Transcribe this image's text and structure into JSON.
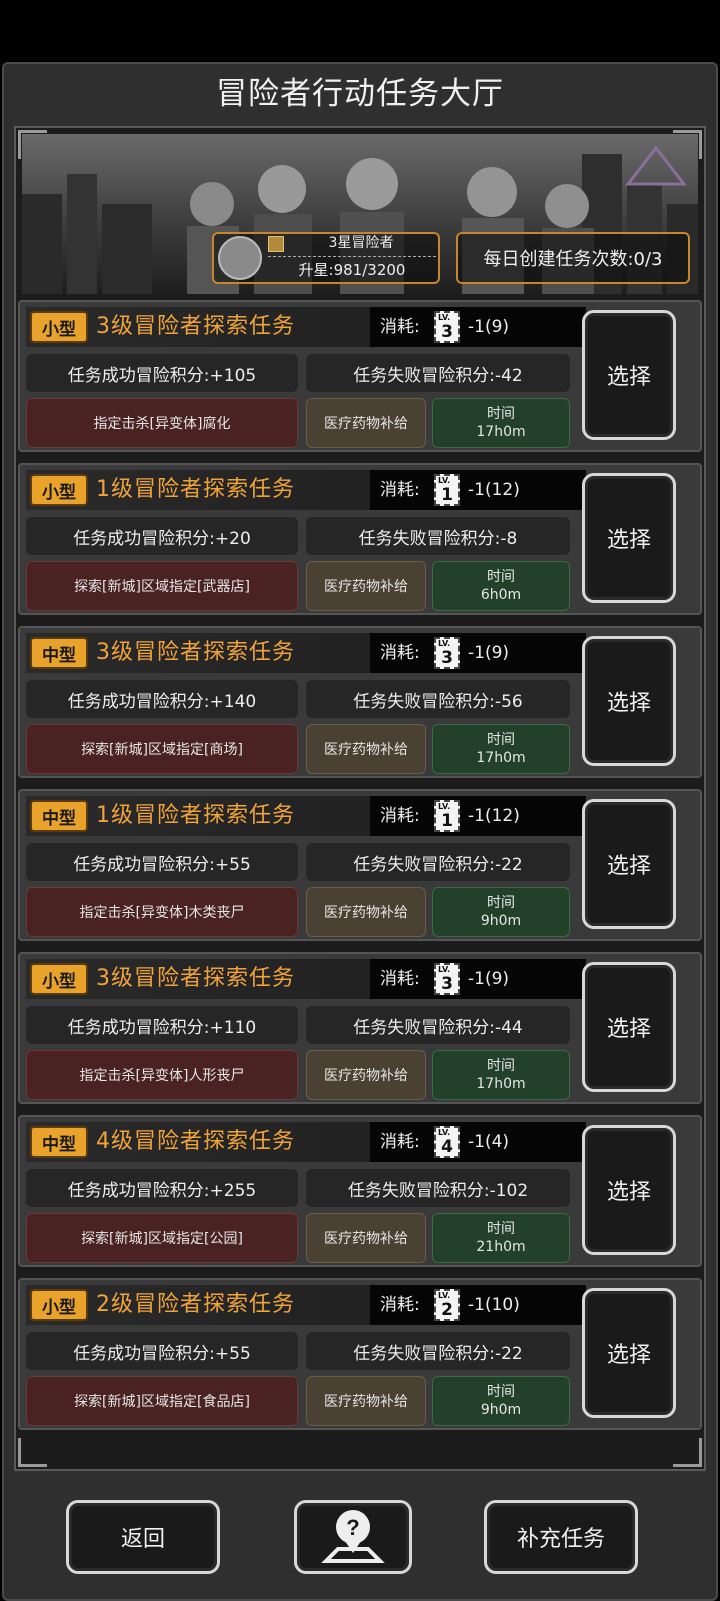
{
  "page": {
    "title": "冒险者行动任务大厅"
  },
  "status": {
    "rank_name": "3星冒险者",
    "rank_progress": "升星:981/3200",
    "daily_created": "每日创建任务次数:0/3"
  },
  "common": {
    "cost_label": "消耗:",
    "select_label": "选择",
    "time_label": "时间",
    "reward_text": "医疗药物补给"
  },
  "tasks": [
    {
      "size": "小型",
      "title": "3级冒险者探索任务",
      "ticket_level": "3",
      "cost": "-1(9)",
      "success": "任务成功冒险积分:+105",
      "fail": "任务失败冒险积分:-42",
      "objective": "指定击杀[异变体]腐化",
      "time": "17h0m"
    },
    {
      "size": "小型",
      "title": "1级冒险者探索任务",
      "ticket_level": "1",
      "cost": "-1(12)",
      "success": "任务成功冒险积分:+20",
      "fail": "任务失败冒险积分:-8",
      "objective": "探索[新城]区域指定[武器店]",
      "time": "6h0m"
    },
    {
      "size": "中型",
      "title": "3级冒险者探索任务",
      "ticket_level": "3",
      "cost": "-1(9)",
      "success": "任务成功冒险积分:+140",
      "fail": "任务失败冒险积分:-56",
      "objective": "探索[新城]区域指定[商场]",
      "time": "17h0m"
    },
    {
      "size": "中型",
      "title": "1级冒险者探索任务",
      "ticket_level": "1",
      "cost": "-1(12)",
      "success": "任务成功冒险积分:+55",
      "fail": "任务失败冒险积分:-22",
      "objective": "指定击杀[异变体]木类丧尸",
      "time": "9h0m"
    },
    {
      "size": "小型",
      "title": "3级冒险者探索任务",
      "ticket_level": "3",
      "cost": "-1(9)",
      "success": "任务成功冒险积分:+110",
      "fail": "任务失败冒险积分:-44",
      "objective": "指定击杀[异变体]人形丧尸",
      "time": "17h0m"
    },
    {
      "size": "中型",
      "title": "4级冒险者探索任务",
      "ticket_level": "4",
      "cost": "-1(4)",
      "success": "任务成功冒险积分:+255",
      "fail": "任务失败冒险积分:-102",
      "objective": "探索[新城]区域指定[公园]",
      "time": "21h0m"
    },
    {
      "size": "小型",
      "title": "2级冒险者探索任务",
      "ticket_level": "2",
      "cost": "-1(10)",
      "success": "任务成功冒险积分:+55",
      "fail": "任务失败冒险积分:-22",
      "objective": "探索[新城]区域指定[食品店]",
      "time": "9h0m"
    }
  ],
  "bottom": {
    "back_label": "返回",
    "help_icon": "help-location-icon",
    "refill_label": "补充任务"
  },
  "colors": {
    "accent_orange": "#f1a33a",
    "size_tag": "#e9a32b",
    "objective_bg": "#4a2222",
    "reward_bg": "#4a4132",
    "time_bg": "#23412a"
  }
}
